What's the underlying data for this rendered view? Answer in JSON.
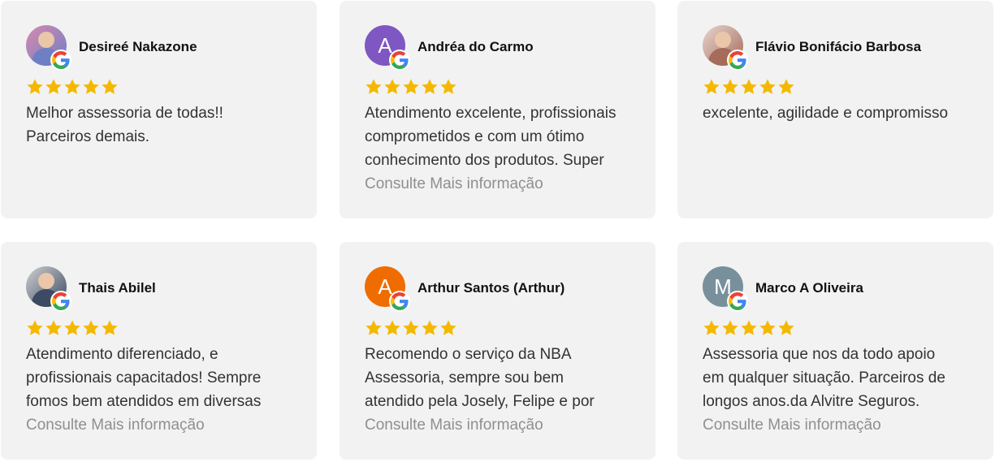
{
  "reviews": [
    {
      "name": "Desireé Nakazone",
      "avatar_type": "photo",
      "avatar_colors": [
        "#d58ab0",
        "#6f7fc4"
      ],
      "rating": 5,
      "text_lines": [
        "Melhor assessoria de todas!!",
        "Parceiros demais."
      ],
      "more_label": ""
    },
    {
      "name": "Andréa do Carmo",
      "avatar_type": "initial",
      "avatar_initial": "A",
      "avatar_color": "#7e57c2",
      "rating": 5,
      "text_lines": [
        "Atendimento excelente, profissionais",
        "comprometidos e com um ótimo",
        "conhecimento dos produtos. Super"
      ],
      "more_label": "Consulte Mais informação"
    },
    {
      "name": "Flávio Bonifácio Barbosa",
      "avatar_type": "photo",
      "avatar_colors": [
        "#e8d5cf",
        "#a56b5b"
      ],
      "rating": 5,
      "text_lines": [
        "excelente, agilidade e compromisso"
      ],
      "more_label": ""
    },
    {
      "name": "Thais Abilel",
      "avatar_type": "photo",
      "avatar_colors": [
        "#cfcfcf",
        "#3c4a63"
      ],
      "rating": 5,
      "text_lines": [
        "Atendimento diferenciado, e",
        "profissionais capacitados! Sempre",
        "fomos bem atendidos em diversas"
      ],
      "more_label": "Consulte Mais informação"
    },
    {
      "name": "Arthur Santos (Arthur)",
      "avatar_type": "initial",
      "avatar_initial": "A",
      "avatar_color": "#ef6c00",
      "rating": 5,
      "text_lines": [
        "Recomendo o serviço da NBA",
        "Assessoria, sempre sou bem",
        "atendido pela Josely, Felipe e por"
      ],
      "more_label": "Consulte Mais informação"
    },
    {
      "name": "Marco A Oliveira",
      "avatar_type": "initial",
      "avatar_initial": "M",
      "avatar_color": "#78909c",
      "rating": 5,
      "text_lines": [
        "Assessoria que nos da todo apoio",
        "em qualquer situação. Parceiros de",
        "longos anos.da Alvitre Seguros."
      ],
      "more_label": "Consulte Mais informação"
    }
  ],
  "colors": {
    "card_bg": "#f2f2f2",
    "star": "#f5b800",
    "more_link": "#8f8f8f"
  },
  "icons": {
    "badge": "google-g-icon",
    "rating": "star-icon"
  }
}
